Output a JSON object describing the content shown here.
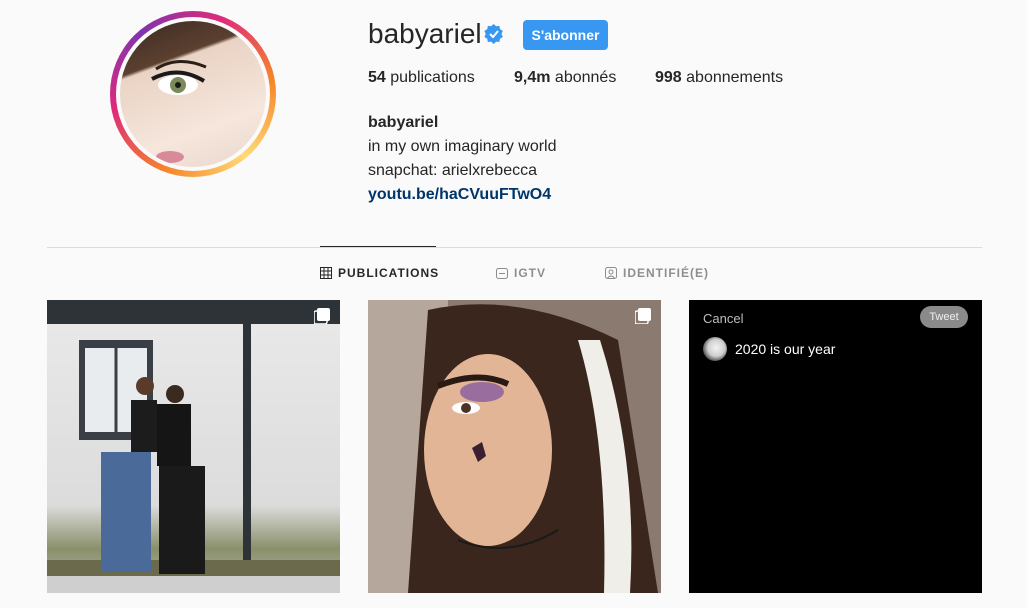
{
  "profile": {
    "username": "babyariel",
    "follow_label": "S'abonner",
    "stats": {
      "posts_count": "54",
      "posts_label": "publications",
      "followers_count": "9,4m",
      "followers_label": "abonnés",
      "following_count": "998",
      "following_label": "abonnements"
    },
    "bio": {
      "name": "babyariel",
      "line1": "in my own imaginary world",
      "line2": "snapchat: arielxrebecca",
      "link": "youtu.be/haCVuuFTwO4"
    }
  },
  "tabs": [
    {
      "label": "PUBLICATIONS",
      "icon": "grid-icon",
      "active": true
    },
    {
      "label": "IGTV",
      "icon": "igtv-icon",
      "active": false
    },
    {
      "label": "IDENTIFIÉ(E)",
      "icon": "tagged-icon",
      "active": false
    }
  ],
  "posts": [
    {
      "type": "photo",
      "multi": true
    },
    {
      "type": "photo",
      "multi": true
    },
    {
      "type": "tweet",
      "cancel_label": "Cancel",
      "tweet_label": "Tweet",
      "text": "2020 is our year"
    }
  ],
  "colors": {
    "accent": "#3897f0",
    "link": "#003569",
    "verified": "#3897f0"
  }
}
